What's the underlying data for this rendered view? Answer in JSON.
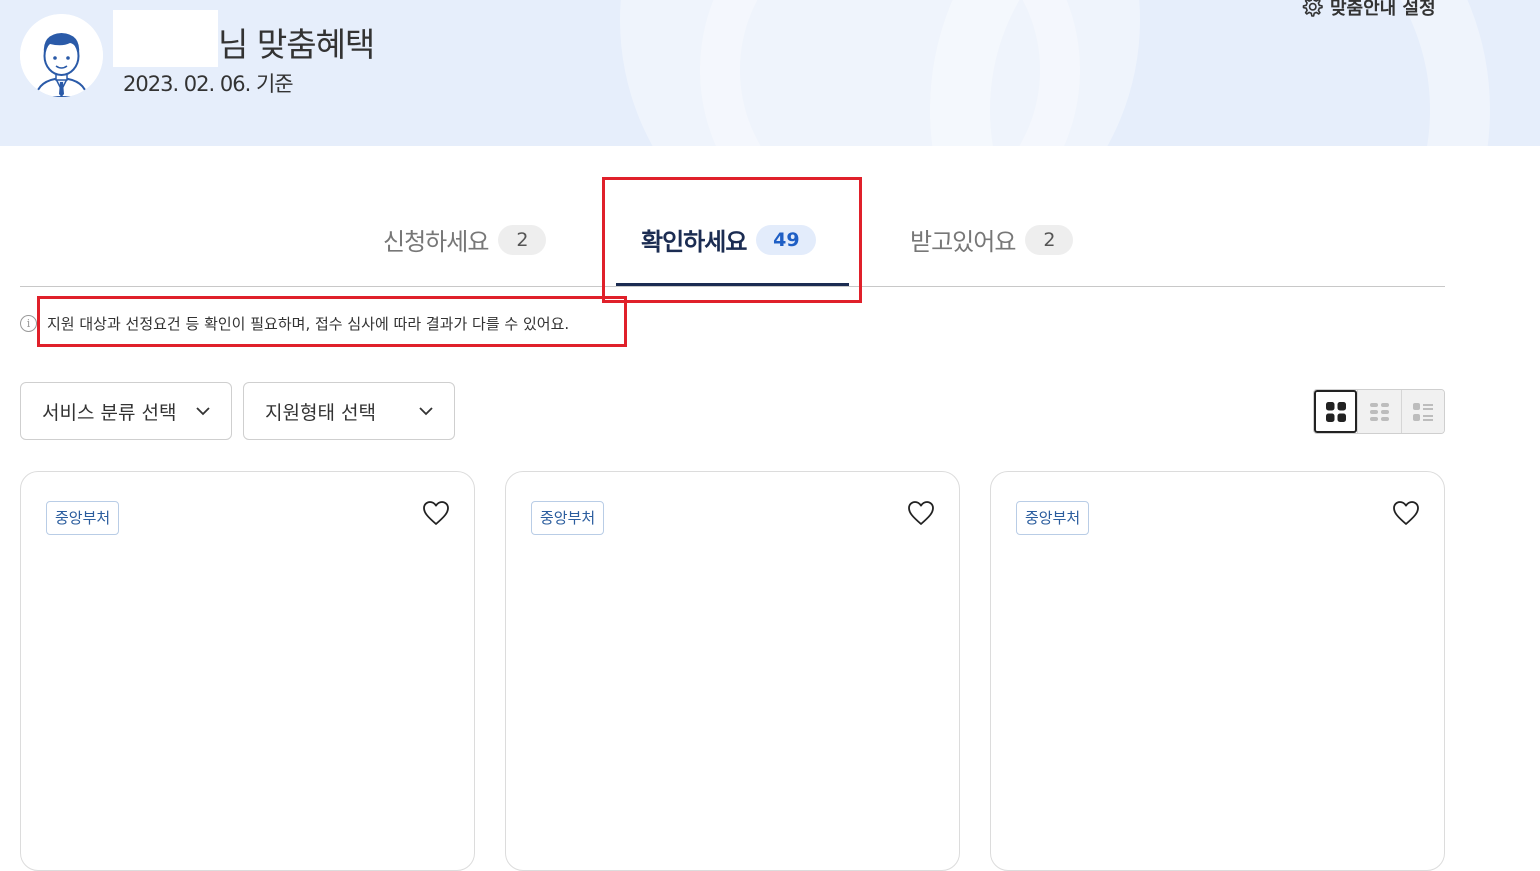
{
  "header": {
    "title_suffix": "님 맞춤혜택",
    "date": "2023. 02. 06. 기준",
    "settings_label": "맞춤안내 설정"
  },
  "tabs": [
    {
      "label": "신청하세요",
      "count": "2",
      "active": false
    },
    {
      "label": "확인하세요",
      "count": "49",
      "active": true
    },
    {
      "label": "받고있어요",
      "count": "2",
      "active": false
    }
  ],
  "notice": {
    "text": "지원 대상과 선정요건 등 확인이 필요하며, 접수 심사에 따라 결과가 다를 수 있어요."
  },
  "filters": {
    "service_category": "서비스 분류 선택",
    "support_type": "지원형태 선택"
  },
  "view_modes": [
    {
      "name": "grid-large-icon",
      "active": true
    },
    {
      "name": "grid-small-icon",
      "active": false
    },
    {
      "name": "list-icon",
      "active": false
    }
  ],
  "cards": [
    {
      "tag": "중앙부처"
    },
    {
      "tag": "중앙부처"
    },
    {
      "tag": "중앙부처"
    }
  ],
  "colors": {
    "hero_bg": "#e6eefb",
    "active_tab": "#1b2c52",
    "active_badge_text": "#1f5fc5",
    "highlight_border": "#e0202a",
    "tag_text": "#2b5d9e"
  }
}
